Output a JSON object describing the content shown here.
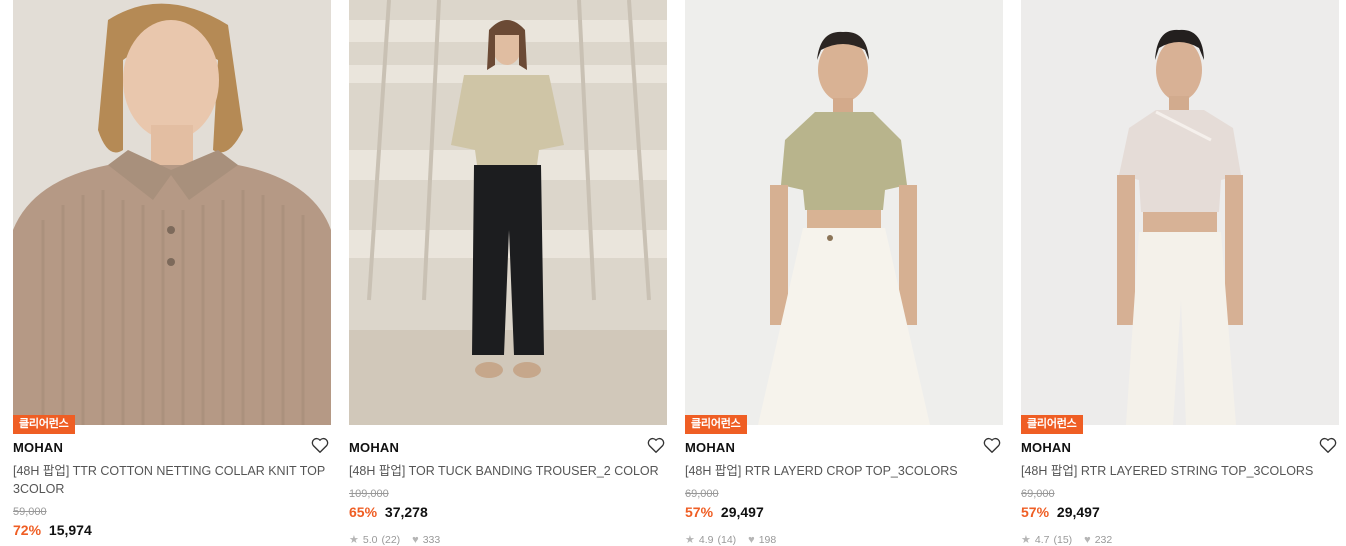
{
  "products": [
    {
      "badge": "클리어런스",
      "brand": "MOHAN",
      "title": "[48H 팝업] TTR COTTON NETTING COLLAR KNIT TOP 3COLOR",
      "original_price": "59,000",
      "discount": "72%",
      "price": "15,974",
      "rating": "",
      "reviews": "",
      "likes": "",
      "image": "model wearing beige ribbed knit polo top"
    },
    {
      "badge": "",
      "brand": "MOHAN",
      "title": "[48H 팝업] TOR TUCK BANDING TROUSER_2 COLOR",
      "original_price": "109,000",
      "discount": "65%",
      "price": "37,278",
      "rating": "5.0",
      "reviews": "(22)",
      "likes": "333",
      "image": "model in wrap blouse and black wide trousers"
    },
    {
      "badge": "클리어런스",
      "brand": "MOHAN",
      "title": "[48H 팝업] RTR LAYERD CROP TOP_3COLORS",
      "original_price": "69,000",
      "discount": "57%",
      "price": "29,497",
      "rating": "4.9",
      "reviews": "(14)",
      "likes": "198",
      "image": "model in khaki layered crop top and white skirt"
    },
    {
      "badge": "클리어런스",
      "brand": "MOHAN",
      "title": "[48H 팝업] RTR LAYERED STRING TOP_3COLORS",
      "original_price": "69,000",
      "discount": "57%",
      "price": "29,497",
      "rating": "4.7",
      "reviews": "(15)",
      "likes": "232",
      "image": "model in light pink layered string top and white pants"
    }
  ],
  "icons": {
    "wishlist": "heart-outline-icon",
    "rating": "star-icon",
    "likes": "heart-filled-icon"
  },
  "colors": {
    "accent": "#ef5e24",
    "badge_bg": "#ef5e24",
    "muted": "#999999"
  }
}
